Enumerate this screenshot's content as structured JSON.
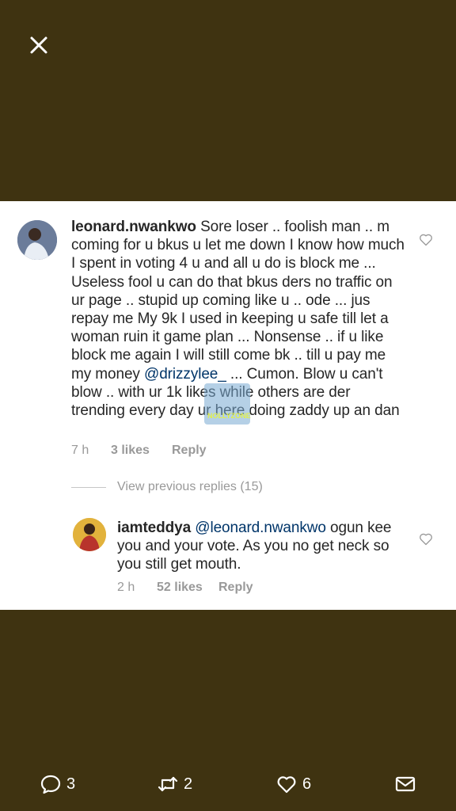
{
  "comment": {
    "username": "leonard.nwankwo",
    "text_before_mention": " Sore loser .. foolish man .. m coming for u bkus u let me down I know how much I spent in voting 4 u and all u do is block me ... Useless fool u can do that bkus ders no traffic on ur page .. stupid up coming like u .. ode ... jus repay me My 9k I used in keeping u safe till let a woman ruin it game plan ... Nonsense .. if u like block me again I will still come bk .. till u pay me my money ",
    "mention": "@drizzylee_",
    "text_after_mention": " ... Cumon. Blow u can't blow .. with ur 1k likes while others are der trending every day ur here doing zaddy up an dan",
    "time": "7 h",
    "likes": "3 likes",
    "reply_label": "Reply"
  },
  "view_previous_replies": "View previous replies (15)",
  "reply": {
    "username": "iamteddya",
    "mention": "@leonard.nwankwo",
    "text": " ogun kee you and your vote. As you no get neck so you still get mouth.",
    "time": "2 h",
    "likes": "52 likes",
    "reply_label": "Reply"
  },
  "watermark": "NOLLYZONE",
  "actions": {
    "reply_count": "3",
    "retweet_count": "2",
    "like_count": "6"
  },
  "icons": {
    "close": "close-icon",
    "heart": "heart-icon",
    "reply": "speech-bubble-icon",
    "retweet": "retweet-icon",
    "like": "heart-icon",
    "mail": "mail-icon"
  },
  "colors": {
    "background": "#3f3311",
    "card": "#ffffff",
    "text": "#262626",
    "mention": "#003569",
    "meta": "#999999"
  }
}
